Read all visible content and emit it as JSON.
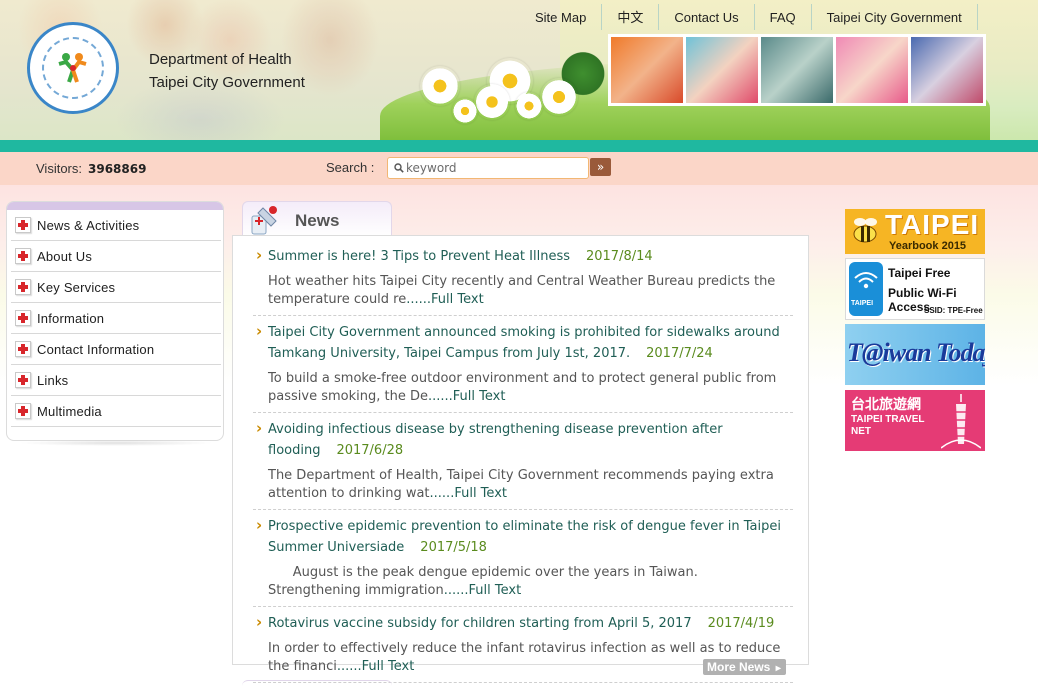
{
  "header": {
    "dept_line1": "Department of Health",
    "dept_line2": "Taipei City Government",
    "top_nav": [
      "Site Map",
      "中文",
      "Contact Us",
      "FAQ",
      "Taipei City Government"
    ],
    "logo_text": "TAIPEI"
  },
  "util": {
    "visitors_label": "Visitors:",
    "visitors_count": "3968869",
    "search_label": "Search :",
    "search_placeholder": "keyword",
    "search_button": "»"
  },
  "left_menu": {
    "items": [
      "News & Activities",
      "About Us",
      "Key Services",
      "Information",
      "Contact Information",
      "Links",
      "Multimedia"
    ]
  },
  "news": {
    "section_title": "News",
    "full_text_label": "......Full Text",
    "more_label": "More News",
    "items": [
      {
        "title": "Summer is here! 3 Tips to Prevent Heat Illness",
        "date": "2017/8/14",
        "summary": "Hot weather hits Taipei City recently and Central Weather Bureau predicts the temperature could re"
      },
      {
        "title": "Taipei City Government announced smoking is prohibited for sidewalks around Tamkang University, Taipei Campus from July 1st, 2017.",
        "date": "2017/7/24",
        "summary": "To build a smoke-free outdoor environment and to protect general public from passive smoking, the De"
      },
      {
        "title": "Avoiding infectious disease by strengthening disease prevention after flooding",
        "date": "2017/6/28",
        "summary": "The Department of Health, Taipei City Government recommends paying extra attention to drinking wat"
      },
      {
        "title": "Prospective epidemic prevention to eliminate the risk of dengue fever in Taipei Summer Universiade",
        "date": "2017/5/18",
        "summary": "      August is the peak dengue epidemic over the years in Taiwan. Strengthening immigration"
      },
      {
        "title": "Rotavirus vaccine subsidy for children starting from April 5, 2017",
        "date": "2017/4/19",
        "summary": "In order to effectively reduce the infant rotavirus infection as well as to reduce the financi"
      }
    ]
  },
  "banners": {
    "yearbook_title": "TAIPEI",
    "yearbook_sub": "Yearbook 2015",
    "wifi_line1": "Taipei Free",
    "wifi_line2": "Public Wi-Fi Access",
    "wifi_ssid": "SSID: TPE-Free",
    "wifi_icon_label": "TAIPEI",
    "taiwantoday": "T@iwan Today",
    "travel_zh": "台北旅遊網",
    "travel_en1": "TAIPEI TRAVEL",
    "travel_en2": "NET"
  },
  "colors": {
    "teal_band": "#1fb8a0",
    "util_bar": "#fbd6c8",
    "link_green": "#1f5e55",
    "date_green": "#5a8b1e",
    "menu_cross": "#d8262b"
  }
}
